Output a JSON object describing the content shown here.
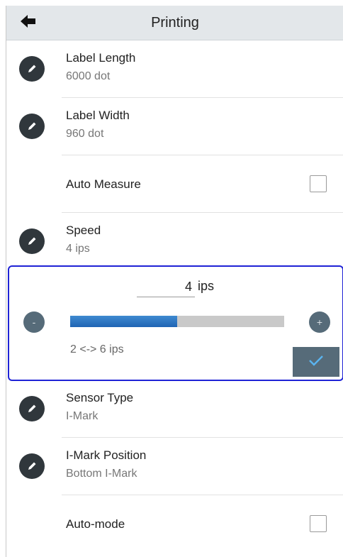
{
  "header": {
    "title": "Printing",
    "back_icon": "arrow-left-icon"
  },
  "settings": {
    "label_length": {
      "label": "Label Length",
      "value": "6000 dot"
    },
    "label_width": {
      "label": "Label Width",
      "value": "960 dot"
    },
    "auto_measure": {
      "label": "Auto Measure",
      "checked": false
    },
    "speed": {
      "label": "Speed",
      "value": "4 ips"
    },
    "sensor_type": {
      "label": "Sensor Type",
      "value": "I-Mark"
    },
    "imark_position": {
      "label": "I-Mark Position",
      "value": "Bottom I-Mark"
    },
    "auto_mode": {
      "label": "Auto-mode",
      "checked": false
    }
  },
  "speed_editor": {
    "value": "4",
    "unit": "ips",
    "min": 2,
    "max": 6,
    "range_label": "2 <-> 6 ips",
    "minus_label": "-",
    "plus_label": "+",
    "slider_fraction": 0.5
  },
  "colors": {
    "editor_border": "#1f23d6",
    "slider_fill": "#2f74c0",
    "button_bg": "#566b79",
    "confirm_check": "#5ab4f0"
  }
}
